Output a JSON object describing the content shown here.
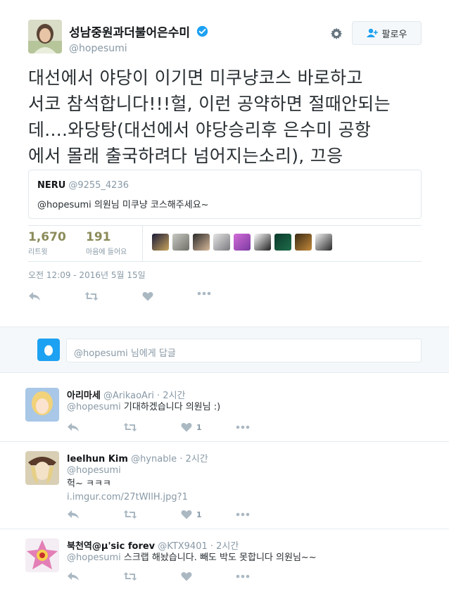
{
  "tweet": {
    "display_name": "성남중원과더불어은수미",
    "handle": "@hopesumi",
    "follow_label": "팔로우",
    "text_lines": [
      "대선에서 야당이 이기면 미쿠냥코스 바로하고",
      "서코 참석합니다!!!헐, 이런 공약하면 절때안되는",
      "데....와당탕(대선에서 야당승리후 은수미 공항",
      "에서 몰래 출국하려다 넘어지는소리), 끄응"
    ],
    "quote": {
      "name": "NERU",
      "handle": "@9255_4236",
      "text": "@hopesumi 의원님 미쿠냥 코스해주세요~"
    },
    "retweets_count": "1,670",
    "retweets_label": "리트윗",
    "likes_count": "191",
    "likes_label": "마음에 들어요",
    "timestamp": "오전 12:09 - 2016년 5월 15일"
  },
  "reply_box": {
    "placeholder": "@hopesumi 님에게 답글"
  },
  "replies": [
    {
      "name": "아리마세",
      "handle": "@ArikaoAri",
      "time": "· 2시간",
      "mention": "@hopesumi",
      "text": " 기대하겠습니다 의원님 :)",
      "extra": "",
      "link": "",
      "likes": "1"
    },
    {
      "name": "leelhun Kim",
      "handle": "@hynable",
      "time": "· 2시간",
      "mention": "@hopesumi",
      "text": "",
      "extra": "헉~ ㅋㅋㅋ",
      "link": "i.imgur.com/27tWIlH.jpg?1",
      "likes": "1"
    },
    {
      "name": "북천역@µ'sic forev",
      "handle": "@KTX9401",
      "time": "· 2시간",
      "mention": "@hopesumi",
      "text": " 스크랩 해놨습니다. 빼도 박도 못합니다 의원님~~",
      "extra": "",
      "link": "",
      "likes": ""
    }
  ],
  "colors": {
    "accent": "#1da1f2",
    "muted": "#8899a6",
    "stat_num": "#8b8b5a"
  },
  "icons": [
    "gear-icon",
    "add-user-icon",
    "verified-icon",
    "reply-icon",
    "retweet-icon",
    "heart-icon",
    "more-icon",
    "egg-icon"
  ]
}
